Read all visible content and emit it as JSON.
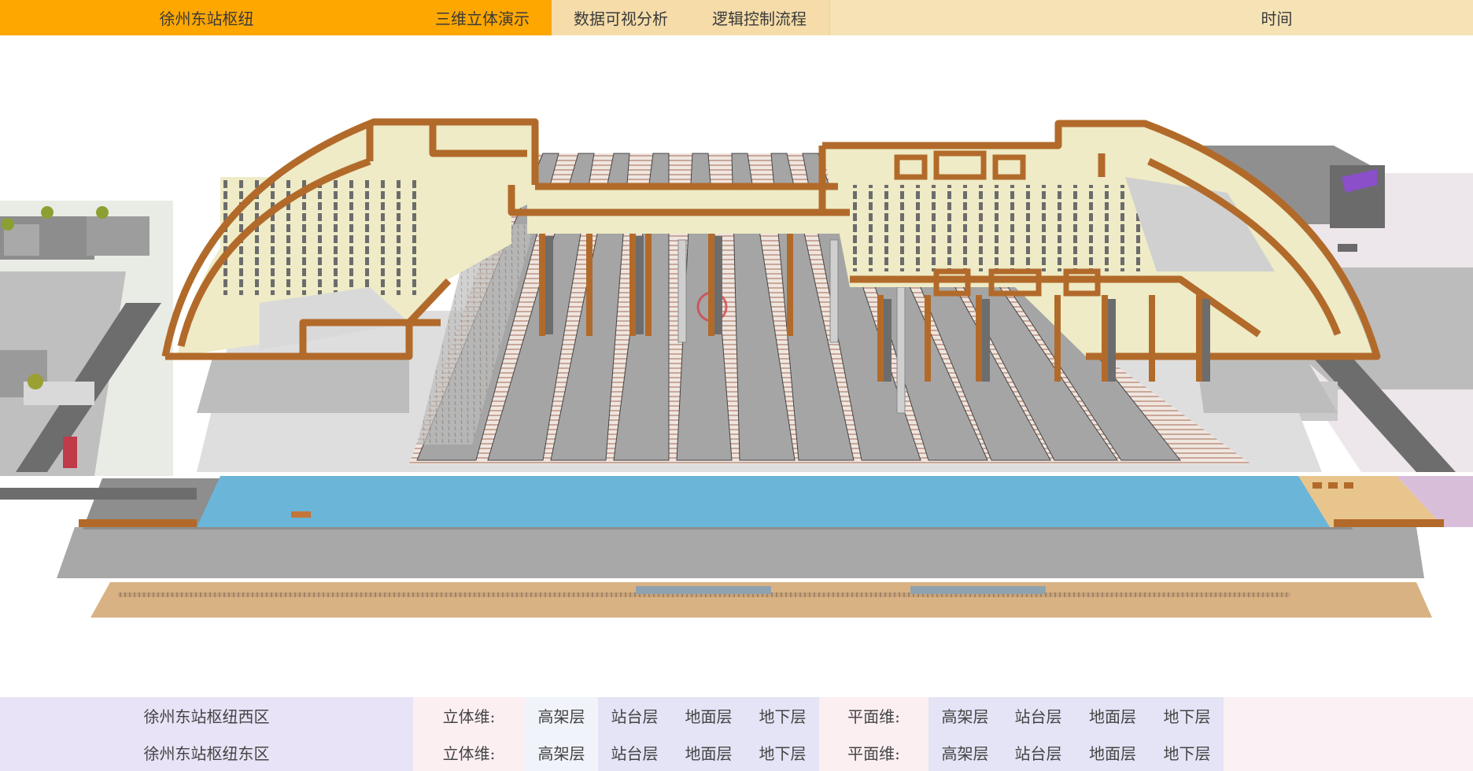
{
  "header": {
    "app_title": "徐州东站枢纽",
    "tabs": [
      {
        "label": "三维立体演示",
        "active": true
      },
      {
        "label": "数据可视分析",
        "active": false
      },
      {
        "label": "逻辑控制流程",
        "active": false
      }
    ],
    "time_label": "时间"
  },
  "zones": [
    {
      "name": "徐州东站枢纽西区",
      "label_3d": "立体维:",
      "layers_3d": [
        "高架层",
        "站台层",
        "地面层",
        "地下层"
      ],
      "label_2d": "平面维:",
      "layers_2d": [
        "高架层",
        "站台层",
        "地面层",
        "地下层"
      ]
    },
    {
      "name": "徐州东站枢纽东区",
      "label_3d": "立体维:",
      "layers_3d": [
        "高架层",
        "站台层",
        "地面层",
        "地下层"
      ],
      "label_2d": "平面维:",
      "layers_2d": [
        "高架层",
        "站台层",
        "地面层",
        "地下层"
      ]
    }
  ],
  "colors": {
    "active_tab": "#fda700",
    "header_bg": "#f5e3b5",
    "wall_brown": "#b26a2a",
    "floor_cream": "#eeebc6",
    "water_blue": "#6ab5d8",
    "platform_grey": "#a9a9a9",
    "underground_tan": "#d9b284"
  },
  "scene": {
    "icon": "station-3d-model"
  }
}
